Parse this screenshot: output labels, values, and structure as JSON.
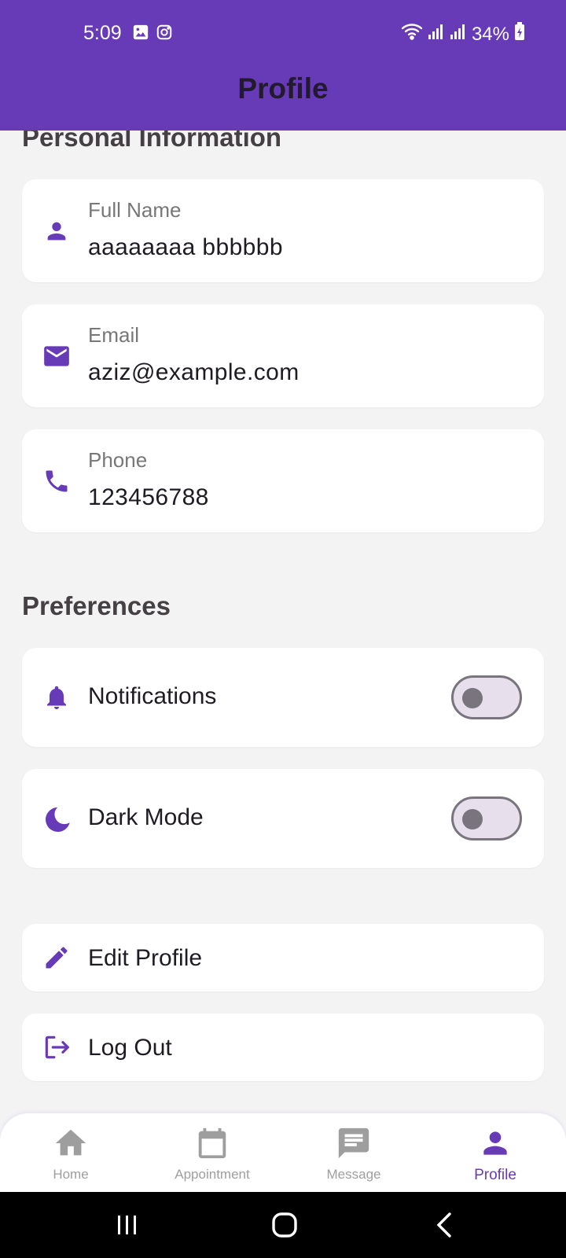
{
  "status_bar": {
    "time": "5:09",
    "battery": "34%"
  },
  "app_bar": {
    "title": "Profile"
  },
  "personal": {
    "section_title": "Personal Information",
    "fields": [
      {
        "label": "Full Name",
        "value": "aaaaaaaa bbbbbb",
        "icon": "person-icon"
      },
      {
        "label": "Email",
        "value": "aziz@example.com",
        "icon": "email-icon"
      },
      {
        "label": "Phone",
        "value": "123456788",
        "icon": "phone-icon"
      }
    ]
  },
  "preferences": {
    "section_title": "Preferences",
    "items": [
      {
        "label": "Notifications",
        "icon": "bell-icon",
        "enabled": false
      },
      {
        "label": "Dark Mode",
        "icon": "moon-icon",
        "enabled": false
      }
    ]
  },
  "actions": [
    {
      "label": "Edit Profile",
      "icon": "pencil-icon"
    },
    {
      "label": "Log Out",
      "icon": "logout-icon"
    }
  ],
  "bottom_nav": {
    "items": [
      {
        "label": "Home",
        "icon": "home-icon",
        "active": false
      },
      {
        "label": "Appointment",
        "icon": "calendar-icon",
        "active": false
      },
      {
        "label": "Message",
        "icon": "message-icon",
        "active": false
      },
      {
        "label": "Profile",
        "icon": "person-icon",
        "active": true
      }
    ]
  },
  "colors": {
    "primary": "#673ab7",
    "background": "#f4f3f4",
    "card": "#ffffff",
    "inactive_nav": "#9e9e9e"
  }
}
